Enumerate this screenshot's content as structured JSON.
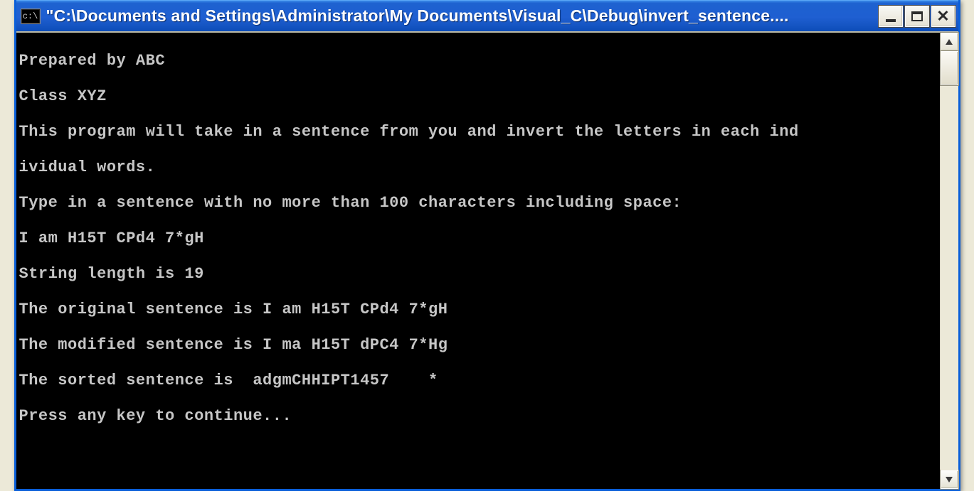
{
  "window": {
    "icon_label": "c:\\",
    "title": "\"C:\\Documents and Settings\\Administrator\\My Documents\\Visual_C\\Debug\\invert_sentence....",
    "controls": {
      "minimize_tooltip": "Minimize",
      "maximize_tooltip": "Maximize",
      "close_tooltip": "Close"
    }
  },
  "console": {
    "lines": [
      "Prepared by ABC",
      "Class XYZ",
      "This program will take in a sentence from you and invert the letters in each ind",
      "ividual words.",
      "Type in a sentence with no more than 100 characters including space:",
      "I am H15T CPd4 7*gH",
      "String length is 19",
      "The original sentence is I am H15T CPd4 7*gH",
      "The modified sentence is I ma H15T dPC4 7*Hg",
      "The sorted sentence is  adgmCHHIPT1457    *",
      "Press any key to continue..."
    ]
  },
  "scrollbar": {
    "up_tooltip": "Scroll up",
    "down_tooltip": "Scroll down"
  }
}
